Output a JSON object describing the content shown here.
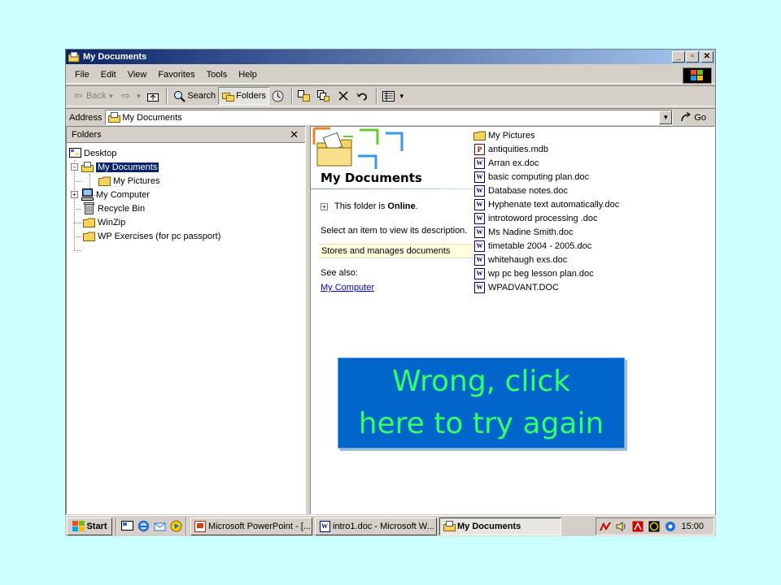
{
  "window": {
    "title": "My Documents",
    "controls": {
      "minimize": "_",
      "maximize": "▫",
      "close": "✕"
    }
  },
  "menu": [
    "File",
    "Edit",
    "View",
    "Favorites",
    "Tools",
    "Help"
  ],
  "toolbar": {
    "back": "Back",
    "search": "Search",
    "folders": "Folders"
  },
  "address": {
    "label": "Address",
    "value": "My Documents",
    "go": "Go"
  },
  "folders_pane": {
    "title": "Folders",
    "close": "✕",
    "tree": [
      {
        "label": "Desktop",
        "icon": "desktop-icon"
      },
      {
        "label": "My Documents",
        "icon": "my-documents-icon",
        "selected": true
      },
      {
        "label": "My Pictures",
        "icon": "folder-icon"
      },
      {
        "label": "My Computer",
        "icon": "computer-icon"
      },
      {
        "label": "Recycle Bin",
        "icon": "recycle-bin-icon"
      },
      {
        "label": "WinZip",
        "icon": "folder-icon"
      },
      {
        "label": "WP Exercises (for pc passport)",
        "icon": "folder-icon"
      }
    ]
  },
  "webview": {
    "title": "My Documents",
    "online_prefix": "This folder is ",
    "online_word": "Online",
    "online_suffix": ".",
    "select_text": "Select an item to view its description.",
    "description": "Stores and manages documents",
    "see_also": "See also:",
    "link": "My Computer"
  },
  "files": [
    {
      "name": "My Pictures",
      "type": "folder"
    },
    {
      "name": "antiquities.mdb",
      "type": "mdb"
    },
    {
      "name": "Arran ex.doc",
      "type": "doc"
    },
    {
      "name": "basic computing plan.doc",
      "type": "doc"
    },
    {
      "name": "Database notes.doc",
      "type": "doc"
    },
    {
      "name": "Hyphenate text automatically.doc",
      "type": "doc"
    },
    {
      "name": "introtoword processing .doc",
      "type": "doc"
    },
    {
      "name": "Ms Nadine Smith.doc",
      "type": "doc"
    },
    {
      "name": "timetable 2004 - 2005.doc",
      "type": "doc"
    },
    {
      "name": "whitehaugh exs.doc",
      "type": "doc"
    },
    {
      "name": "wp pc beg lesson plan.doc",
      "type": "doc"
    },
    {
      "name": "WPADVANT.DOC",
      "type": "doc"
    }
  ],
  "overlay": {
    "line1": "Wrong, click",
    "line2": "here to try again"
  },
  "taskbar": {
    "start": "Start",
    "tasks": [
      {
        "label": "Microsoft PowerPoint - [...",
        "icon": "powerpoint-icon"
      },
      {
        "label": "intro1.doc - Microsoft W...",
        "icon": "word-doc-icon"
      },
      {
        "label": "My Documents",
        "icon": "my-documents-icon",
        "active": true
      }
    ],
    "clock": "15:00"
  },
  "colors": {
    "background": "#ccffff",
    "title_bar": "#0a246a",
    "overlay_bg": "#0066cc",
    "overlay_text": "#33ff66",
    "selection": "#0a246a"
  }
}
